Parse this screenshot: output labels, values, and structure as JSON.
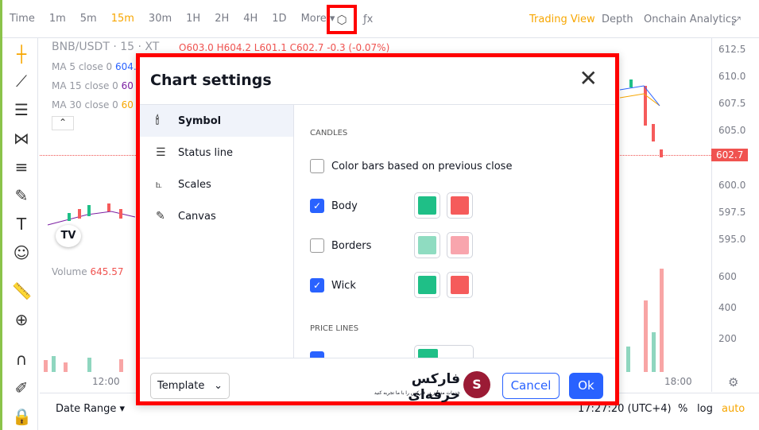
{
  "topbar": {
    "intervals": [
      "Time",
      "1m",
      "5m",
      "15m",
      "30m",
      "1H",
      "2H",
      "4H",
      "1D",
      "More ▾"
    ],
    "active": "15m",
    "fx": "ƒx",
    "trading_view": "Trading View",
    "depth": "Depth",
    "onchain": "Onchain Analytics"
  },
  "legend": {
    "symbol": "BNB/USDT · 15 · XT",
    "ohlc": "O603.0 H604.2 L601.1 C602.7 -0.3 (-0.07%)",
    "ma5": "MA 5 close 0",
    "ma5v": "604.",
    "ma15": "MA 15 close 0",
    "ma15v": "60",
    "ma30": "MA 30 close 0",
    "ma30v": "60",
    "volume": "Volume",
    "volume_v": "645.57"
  },
  "axis": {
    "prices": [
      "612.5",
      "610.0",
      "607.5",
      "605.0",
      "600.0",
      "597.5",
      "595.0"
    ],
    "last": "602.7",
    "volumes": [
      "600",
      "400",
      "200"
    ],
    "times": [
      "12:00",
      "18:00"
    ]
  },
  "bottom": {
    "date_range": "Date Range ▾",
    "clock": "17:27:20 (UTC+4)",
    "pct": "%",
    "log": "log",
    "auto": "auto"
  },
  "dialog": {
    "title": "Chart settings",
    "tabs": [
      "Symbol",
      "Status line",
      "Scales",
      "Canvas"
    ],
    "candles_header": "CANDLES",
    "color_bars": "Color bars based on previous close",
    "rows": [
      {
        "label": "Body",
        "checked": true
      },
      {
        "label": "Borders",
        "checked": false
      },
      {
        "label": "Wick",
        "checked": true
      }
    ],
    "price_lines_header": "PRICE LINES",
    "template": "Template",
    "cancel": "Cancel",
    "ok": "Ok",
    "logo_text": "فارکس حرفه‌ای",
    "logo_sub": "خدمات متمایز در فارکس را با ما تجربه کنید"
  },
  "colors": {
    "up": "#1fbf87",
    "down": "#f55b5b",
    "accent": "#2962ff",
    "highlight": "#ff0000"
  }
}
